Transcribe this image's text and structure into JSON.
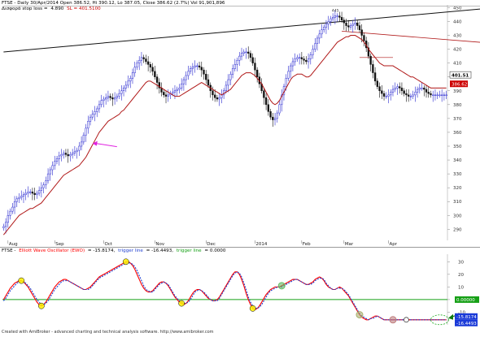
{
  "price_header": {
    "symbol_line": "FTSE - Daily 30/Apr/2014 Open 386.52, Hi 390.12, Lo 387.05, Close 386.62 (2.7%) Vol 91,901,896",
    "stop_line_prefix": "Δισφορά stop loss =",
    "stop_value": "4.890",
    "sl_label": "SL = 401.5100"
  },
  "osc_header": {
    "prefix": "FTSE -",
    "title": "Elliott Wave Oscillator (EWO)",
    "ewo_value": "= -15.8174,",
    "trigger_label": "trigger line",
    "trigger_value": "= -16.4493,",
    "trigger_label2": "trigger line",
    "trigger_value2": "= 0.0000"
  },
  "footer": "Created with AmiBroker - advanced charting and technical analysis software. http://www.amibroker.com",
  "colors": {
    "up_bar": "#2a2ad0",
    "down_bar": "#111111",
    "trail": "#b01818",
    "trendline": "#111111",
    "osc": "#ff0000",
    "trigger": "#1f3fd0",
    "zero_line": "#16a016",
    "last_price": "#cc0000",
    "ewo_badge": "#1a3ad8",
    "zero_badge": "#16a016",
    "arrow_magenta": "#e020e0",
    "arrow_green": "#117a11"
  },
  "chart_data": [
    {
      "type": "candlestick",
      "title": "FTSE - Daily",
      "y_ticks": [
        290,
        300,
        310,
        320,
        330,
        340,
        350,
        360,
        370,
        380,
        390,
        400,
        410,
        420,
        430,
        440,
        450
      ],
      "ylim": [
        282,
        452
      ],
      "x_labels": [
        "Aug",
        "Sep",
        "Oct",
        "Nov",
        "Dec",
        "2014",
        "Feb",
        "Mar",
        "Apr"
      ],
      "x_label_index": [
        2,
        23,
        45,
        68,
        91,
        113,
        134,
        153,
        173
      ],
      "n_bars": 200,
      "last_price_label": "401.51",
      "last_close_label": "386.62",
      "peak_label": "445",
      "close": [
        292,
        295,
        300,
        303,
        306,
        310,
        312,
        313,
        314,
        315,
        316,
        317,
        317,
        316,
        315,
        316,
        318,
        320,
        322,
        325,
        330,
        333,
        336,
        339,
        341,
        343,
        344,
        345,
        344,
        343,
        344,
        345,
        346,
        347,
        350,
        353,
        358,
        363,
        368,
        371,
        373,
        375,
        377,
        380,
        383,
        384,
        385,
        386,
        385,
        384,
        385,
        386,
        388,
        390,
        392,
        394,
        397,
        399,
        403,
        407,
        410,
        412,
        414,
        413,
        411,
        409,
        407,
        404,
        400,
        396,
        392,
        389,
        387,
        386,
        387,
        388,
        389,
        390,
        391,
        392,
        395,
        398,
        401,
        404,
        406,
        407,
        408,
        408,
        407,
        405,
        402,
        398,
        394,
        390,
        387,
        385,
        384,
        385,
        387,
        390,
        394,
        398,
        402,
        406,
        409,
        412,
        415,
        417,
        418,
        418,
        417,
        414,
        410,
        405,
        400,
        395,
        390,
        385,
        380,
        375,
        371,
        369,
        370,
        374,
        380,
        387,
        393,
        399,
        404,
        408,
        411,
        413,
        414,
        414,
        413,
        412,
        411,
        413,
        416,
        420,
        424,
        428,
        431,
        434,
        436,
        438,
        440,
        442,
        443,
        444,
        444,
        443,
        441,
        439,
        437,
        436,
        437,
        438,
        439,
        437,
        434,
        430,
        426,
        421,
        415,
        409,
        403,
        397,
        393,
        390,
        388,
        386,
        386,
        387,
        389,
        391,
        392,
        393,
        392,
        390,
        388,
        387,
        386,
        386,
        387,
        389,
        391,
        392,
        392,
        391,
        389,
        388,
        387,
        387,
        387,
        387,
        387,
        387,
        387,
        387
      ],
      "trail": [
        286,
        288,
        290,
        292,
        294,
        296,
        298,
        300,
        301,
        302,
        303,
        304,
        305,
        305,
        306,
        307,
        308,
        309,
        311,
        313,
        315,
        317,
        319,
        321,
        323,
        325,
        327,
        329,
        330,
        331,
        332,
        333,
        334,
        335,
        336,
        338,
        340,
        342,
        345,
        348,
        351,
        354,
        357,
        360,
        362,
        364,
        366,
        368,
        369,
        370,
        371,
        372,
        373,
        375,
        376,
        378,
        380,
        382,
        384,
        386,
        388,
        390,
        392,
        394,
        396,
        397,
        397,
        396,
        395,
        394,
        393,
        392,
        391,
        390,
        389,
        388,
        387,
        386,
        386,
        386,
        387,
        388,
        389,
        390,
        391,
        392,
        393,
        394,
        395,
        396,
        395,
        394,
        393,
        392,
        391,
        390,
        389,
        388,
        387,
        388,
        389,
        390,
        391,
        393,
        395,
        397,
        399,
        401,
        402,
        403,
        403,
        403,
        402,
        401,
        399,
        397,
        395,
        392,
        389,
        386,
        383,
        381,
        380,
        381,
        383,
        386,
        389,
        392,
        395,
        398,
        400,
        401,
        402,
        402,
        402,
        401,
        400,
        400,
        401,
        403,
        405,
        407,
        409,
        411,
        413,
        415,
        417,
        419,
        421,
        423,
        425,
        426,
        427,
        428,
        429,
        429,
        430,
        430,
        430,
        429,
        428,
        427,
        425,
        423,
        420,
        418,
        416,
        414,
        412,
        410,
        409,
        408,
        408,
        408,
        408,
        408,
        407,
        406,
        405,
        404,
        403,
        402,
        401,
        400,
        400,
        399,
        398,
        397,
        396,
        395,
        394,
        393,
        392,
        392,
        392,
        392,
        392,
        392,
        392,
        392
      ]
    },
    {
      "type": "line",
      "title": "Elliott Wave Oscillator (EWO)",
      "y_ticks": [
        -10,
        0,
        10,
        20,
        30
      ],
      "ylim": [
        -20,
        36
      ],
      "zero_label": "0.00000",
      "ewo_label": "-15.8174",
      "trigger_label": "-16.4493",
      "ewo": [
        0,
        3,
        6,
        9,
        11,
        13,
        14,
        15,
        15,
        14,
        12,
        10,
        7,
        4,
        1,
        -2,
        -4,
        -5,
        -4,
        -2,
        1,
        4,
        7,
        10,
        12,
        14,
        15,
        16,
        16,
        15,
        14,
        13,
        12,
        11,
        10,
        9,
        8,
        8,
        9,
        10,
        12,
        14,
        16,
        18,
        19,
        20,
        21,
        22,
        23,
        24,
        25,
        26,
        27,
        28,
        29,
        30,
        30,
        29,
        27,
        24,
        20,
        16,
        12,
        9,
        7,
        6,
        6,
        7,
        9,
        11,
        13,
        14,
        14,
        13,
        11,
        8,
        5,
        2,
        0,
        -2,
        -3,
        -4,
        -3,
        -1,
        2,
        5,
        7,
        8,
        8,
        7,
        5,
        3,
        1,
        0,
        -1,
        -1,
        0,
        2,
        5,
        8,
        11,
        14,
        17,
        20,
        22,
        22,
        20,
        16,
        11,
        5,
        0,
        -4,
        -7,
        -8,
        -7,
        -5,
        -2,
        1,
        4,
        6,
        8,
        9,
        10,
        10,
        10,
        11,
        12,
        13,
        14,
        15,
        16,
        16,
        16,
        15,
        14,
        13,
        12,
        12,
        13,
        14,
        16,
        17,
        18,
        17,
        15,
        12,
        10,
        9,
        8,
        8,
        9,
        10,
        9,
        7,
        5,
        3,
        0,
        -3,
        -6,
        -9,
        -12,
        -14,
        -15,
        -16,
        -16,
        -15,
        -14,
        -13,
        -13,
        -14,
        -15,
        -16,
        -16,
        -16,
        -16,
        -16,
        -16,
        -16,
        -16,
        -16,
        -16,
        -16,
        -16,
        -16,
        -16,
        -16,
        -16,
        -16,
        -16,
        -16,
        -16,
        -16,
        -16,
        -16,
        -16,
        -16,
        -16,
        -16,
        -16,
        -16
      ],
      "trigger": [
        -1,
        1,
        4,
        7,
        9,
        11,
        13,
        14,
        14,
        14,
        13,
        11,
        9,
        6,
        3,
        0,
        -2,
        -4,
        -4,
        -3,
        -1,
        2,
        5,
        8,
        10,
        12,
        14,
        15,
        15,
        15,
        14,
        13,
        12,
        11,
        10,
        9,
        8,
        8,
        8,
        9,
        11,
        13,
        15,
        17,
        18,
        19,
        20,
        21,
        22,
        23,
        24,
        25,
        26,
        27,
        28,
        29,
        29,
        29,
        28,
        26,
        23,
        19,
        15,
        11,
        8,
        7,
        6,
        6,
        8,
        10,
        12,
        13,
        14,
        13,
        12,
        9,
        6,
        3,
        1,
        -1,
        -2,
        -3,
        -3,
        -2,
        0,
        3,
        6,
        7,
        8,
        7,
        6,
        4,
        2,
        0,
        -1,
        -1,
        -1,
        1,
        4,
        7,
        10,
        13,
        16,
        19,
        21,
        22,
        21,
        18,
        13,
        8,
        2,
        -2,
        -5,
        -7,
        -7,
        -6,
        -4,
        -1,
        2,
        5,
        7,
        8,
        9,
        10,
        10,
        10,
        11,
        12,
        13,
        14,
        15,
        16,
        16,
        15,
        14,
        13,
        12,
        12,
        12,
        13,
        15,
        16,
        17,
        17,
        16,
        13,
        11,
        9,
        8,
        8,
        9,
        9,
        9,
        8,
        6,
        4,
        1,
        -2,
        -5,
        -8,
        -11,
        -13,
        -14,
        -15,
        -16,
        -15,
        -15,
        -14,
        -13,
        -14,
        -15,
        -16,
        -16,
        -16,
        -16,
        -16,
        -16,
        -16,
        -16,
        -16,
        -16,
        -16,
        -16,
        -16,
        -16,
        -16,
        -16,
        -16,
        -16,
        -16,
        -16,
        -16,
        -16,
        -16,
        -16,
        -16,
        -16,
        -16,
        -16,
        -16
      ]
    }
  ]
}
